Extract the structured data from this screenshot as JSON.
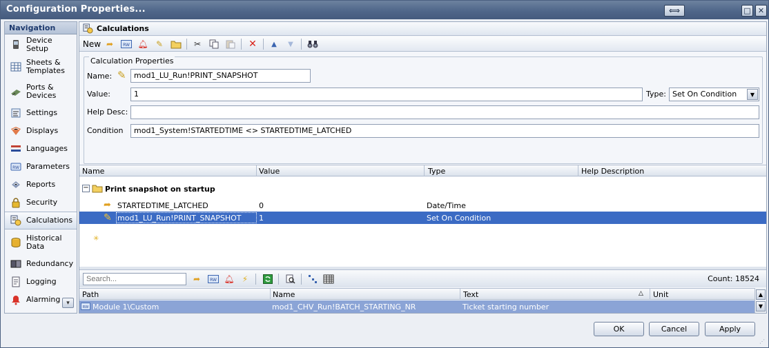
{
  "window": {
    "title": "Configuration Properties..."
  },
  "navigation": {
    "header": "Navigation",
    "items": [
      {
        "label": "Device Setup",
        "icon": "device-icon"
      },
      {
        "label": "Sheets & Templates",
        "icon": "sheets-icon"
      },
      {
        "label": "Ports & Devices",
        "icon": "ports-icon"
      },
      {
        "label": "Settings",
        "icon": "settings-icon"
      },
      {
        "label": "Displays",
        "icon": "displays-icon"
      },
      {
        "label": "Languages",
        "icon": "languages-icon"
      },
      {
        "label": "Parameters",
        "icon": "parameters-icon"
      },
      {
        "label": "Reports",
        "icon": "reports-icon"
      },
      {
        "label": "Security",
        "icon": "lock-icon"
      },
      {
        "label": "Calculations",
        "icon": "calculations-icon"
      },
      {
        "label": "Historical Data",
        "icon": "database-icon"
      },
      {
        "label": "Redundancy",
        "icon": "redundancy-icon"
      },
      {
        "label": "Logging",
        "icon": "logging-icon"
      },
      {
        "label": "Alarming",
        "icon": "bell-icon"
      }
    ],
    "active": "Calculations"
  },
  "main": {
    "title": "Calculations",
    "toolbar": {
      "new_label": "New"
    },
    "properties": {
      "group_title": "Calculation Properties",
      "name_label": "Name:",
      "name_value": "mod1_LU_Run!PRINT_SNAPSHOT",
      "value_label": "Value:",
      "value_value": "1",
      "type_label": "Type:",
      "type_value": "Set On Condition",
      "help_label": "Help Desc:",
      "help_value": "",
      "condition_label": "Condition",
      "condition_value": "mod1_System!STARTEDTIME <> STARTEDTIME_LATCHED"
    },
    "grid": {
      "columns": [
        "Name",
        "Value",
        "Type",
        "Help Description"
      ],
      "group_label": "Print snapshot on startup",
      "rows": [
        {
          "name": "STARTEDTIME_LATCHED",
          "value": "0",
          "type": "Date/Time",
          "help": ""
        },
        {
          "name": "mod1_LU_Run!PRINT_SNAPSHOT",
          "value": "1",
          "type": "Set On Condition",
          "help": ""
        }
      ]
    },
    "search": {
      "placeholder": "Search...",
      "count_label": "Count: 18524",
      "columns": [
        "Path",
        "Name",
        "Text",
        "Unit"
      ],
      "rows": [
        {
          "path": "Module 1\\Custom",
          "name": "mod1_CHV_Run!BATCH_STARTING_NR",
          "text": "Ticket starting number",
          "unit": ""
        }
      ]
    }
  },
  "footer": {
    "ok": "OK",
    "cancel": "Cancel",
    "apply": "Apply"
  }
}
